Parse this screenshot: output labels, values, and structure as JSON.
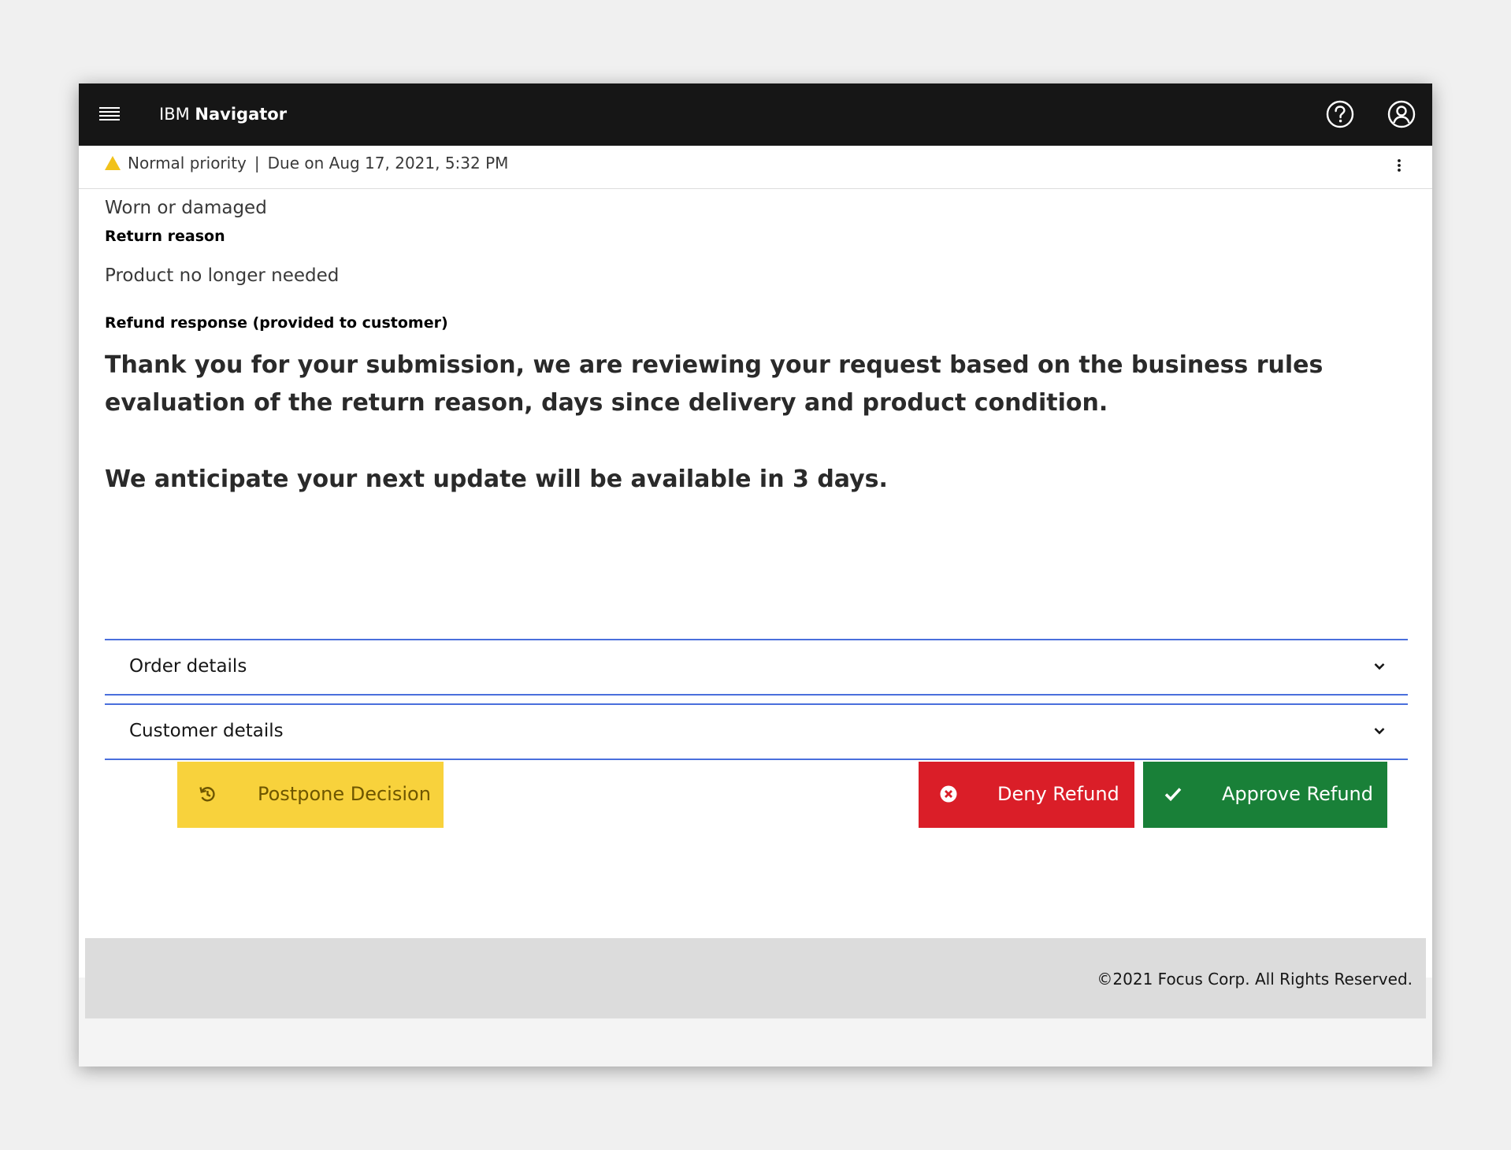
{
  "header": {
    "brand_prefix": "IBM",
    "brand_name": "Navigator"
  },
  "task": {
    "priority": "Normal priority",
    "separator": "|",
    "due": "Due on Aug 17, 2021, 5:32 PM"
  },
  "details": {
    "condition_value": "Worn or damaged",
    "return_reason_label": "Return reason",
    "return_reason_value": "Product no longer needed",
    "refund_response_label": "Refund response (provided to customer)",
    "message_line1": "Thank you for your submission, we are reviewing your request based on the business rules evaluation of the return reason, days since delivery and product condition.",
    "message_line2": "We anticipate your next update will be available in 3 days."
  },
  "accordions": [
    {
      "label": "Order details"
    },
    {
      "label": "Customer details"
    }
  ],
  "actions": {
    "postpone_label": "Postpone Decision",
    "deny_label": "Deny Refund",
    "approve_label": "Approve Refund"
  },
  "footer": {
    "copyright": "©2021 Focus Corp. All Rights Reserved."
  },
  "colors": {
    "topbar": "#161616",
    "accordion_border": "#4a6fdc",
    "postpone": "#f8d23c",
    "deny": "#da1e28",
    "approve": "#198038",
    "warning_icon": "#f1c21b"
  },
  "icons": {
    "menu": "hamburger-menu-icon",
    "help": "help-icon",
    "user": "user-avatar-icon",
    "priority": "warning-triangle-icon",
    "overflow": "overflow-menu-icon",
    "expand": "chevron-down-icon",
    "postpone": "history-icon",
    "deny": "close-circle-icon",
    "approve": "checkmark-icon"
  }
}
